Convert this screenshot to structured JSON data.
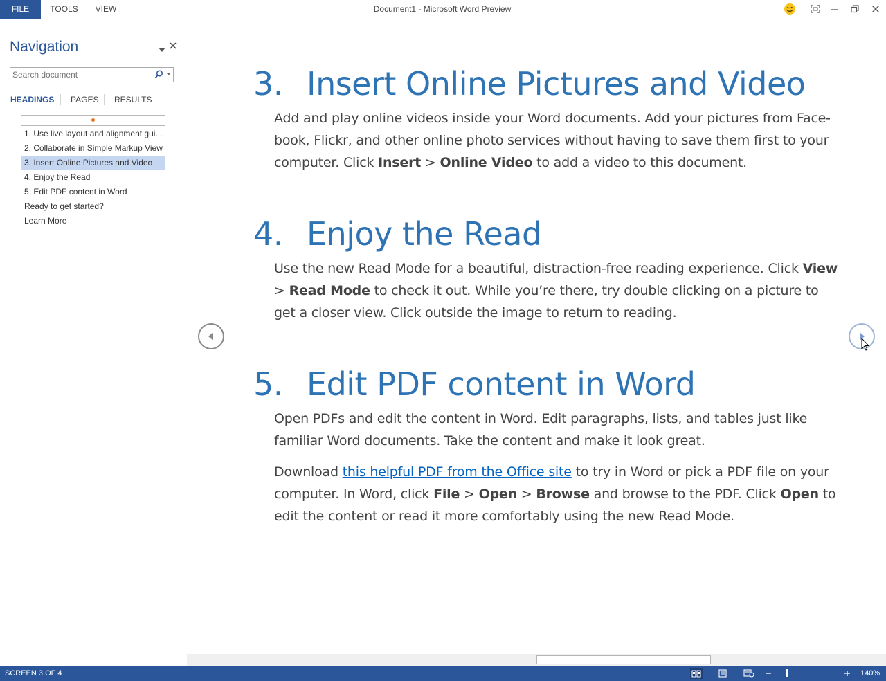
{
  "menu": {
    "file": "FILE",
    "tools": "TOOLS",
    "view": "VIEW"
  },
  "window": {
    "title": "Document1 - Microsoft Word Preview"
  },
  "navigation": {
    "title": "Navigation",
    "search_placeholder": "Search document",
    "tabs": {
      "headings": "HEADINGS",
      "pages": "PAGES",
      "results": "RESULTS"
    },
    "headings": [
      "1. Use live layout and alignment gui...",
      "2. Collaborate in Simple Markup View",
      "3. Insert Online Pictures and Video",
      "4. Enjoy the Read",
      "5. Edit PDF content in Word",
      "Ready to get started?",
      "Learn More"
    ],
    "active_heading_index": 2
  },
  "document": {
    "sections": [
      {
        "number": "3.",
        "title": "Insert Online Pictures and Video",
        "paragraph": {
          "t1": "Add and play online videos inside your Word documents. Add your pictures from Face-book, Flickr, and other online photo services without having to save them first to your computer. Click ",
          "b1": "Insert",
          "t2": " > ",
          "b2": "Online Video",
          "t3": " to add a video to this document."
        }
      },
      {
        "number": "4.",
        "title": "Enjoy the Read",
        "paragraph": {
          "t1": "Use the new Read Mode for a beautiful, distraction-free reading experience. Click ",
          "b1": "View",
          "t2": " > ",
          "b2": "Read Mode",
          "t3": " to check it out. While you’re there, try double clicking on a picture to get a closer view. Click outside the image to return to reading."
        }
      },
      {
        "number": "5.",
        "title": "Edit PDF content in Word",
        "paragraph": {
          "t1": "Open PDFs and edit the content in Word. Edit paragraphs, lists, and tables just like familiar Word documents. Take the content and make it look great."
        },
        "paragraph2": {
          "t1": "Download ",
          "link": "this helpful PDF from the Office site",
          "t2": " to try in Word or pick a PDF file on your computer.  In Word, click ",
          "b1": "File",
          "t3": " > ",
          "b2": "Open",
          "t4": " > ",
          "b3": "Browse",
          "t5": " and browse to the PDF. Click ",
          "b4": "Open",
          "t6": " to edit the content or read it more comfortably using the new Read Mode."
        }
      }
    ]
  },
  "status": {
    "screen": "SCREEN 3 OF 4",
    "zoom": "140%"
  },
  "colors": {
    "accent": "#2b579a",
    "heading": "#2e74b5",
    "link": "#0563c1",
    "active_heading_bg": "#c5d6f1",
    "progress_dot": "#e8731c"
  }
}
